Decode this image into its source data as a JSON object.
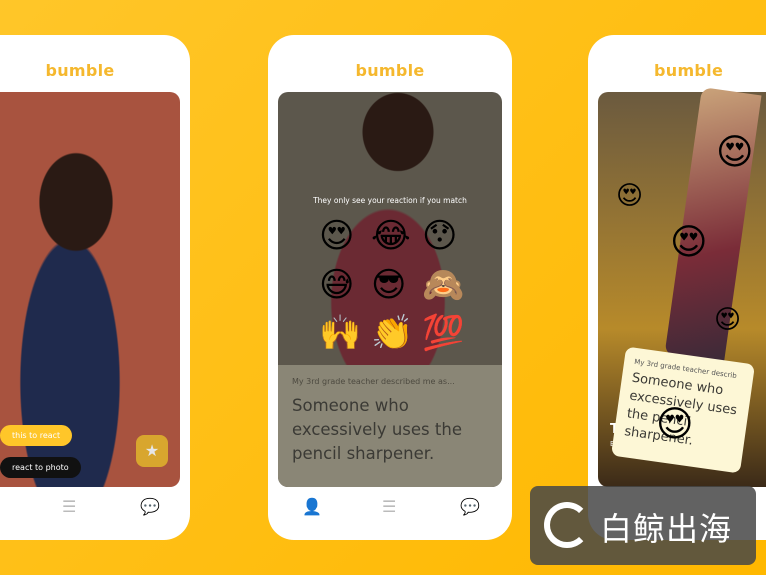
{
  "brand": "bumble",
  "colors": {
    "accent": "#ffc629",
    "logo": "#f5b82e"
  },
  "phone1": {
    "react_pill": "this to react",
    "photo_pill": "react to photo",
    "superswipe_icon": "star-icon"
  },
  "phone2": {
    "hint": "They only see your reaction if you match",
    "emojis": [
      "😍",
      "😂",
      "😯",
      "😅",
      "😎",
      "🙈",
      "🙌",
      "👏",
      "💯"
    ],
    "prompt": "My 3rd grade teacher described me as...",
    "answer": "Someone who excessively uses the pencil sharpener."
  },
  "phone3": {
    "prompt": "My 3rd grade teacher describ",
    "answer": "Someone who excessively uses the pencil sharpener.",
    "name_partial": "Ti",
    "sub_partial": "Ed",
    "emoji": "😍"
  },
  "nav": {
    "icons": [
      "profile-icon",
      "stack-icon",
      "chat-icon"
    ]
  },
  "watermark": "白鲸出海"
}
